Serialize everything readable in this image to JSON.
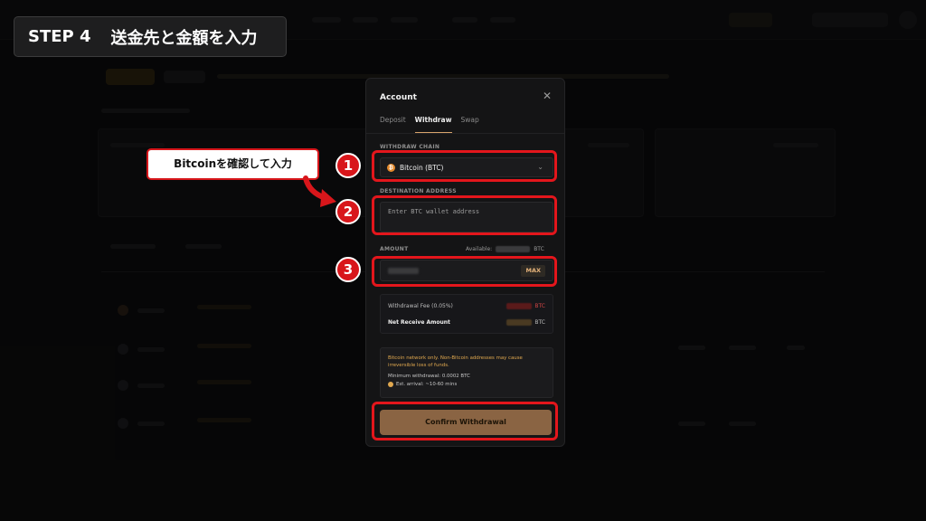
{
  "step_label": {
    "step": "STEP 4",
    "title": "送金先と金額を入力"
  },
  "modal": {
    "title": "Account",
    "close_icon": "close-icon",
    "tabs": [
      {
        "label": "Deposit",
        "active": false
      },
      {
        "label": "Withdraw",
        "active": true
      },
      {
        "label": "Swap",
        "active": false
      }
    ],
    "chain": {
      "label": "WITHDRAW CHAIN",
      "value": "Bitcoin (BTC)",
      "icon": "bitcoin-icon"
    },
    "destination": {
      "label": "DESTINATION ADDRESS",
      "placeholder": "Enter BTC wallet address"
    },
    "amount": {
      "label": "AMOUNT",
      "available_label": "Available:",
      "unit": "BTC",
      "max_label": "MAX"
    },
    "fees": {
      "fee_label": "Withdrawal Fee (0.05%)",
      "fee_unit": "BTC",
      "net_label": "Net Receive Amount",
      "net_unit": "BTC"
    },
    "notice": {
      "warning": "Bitcoin network only. Non-Bitcoin addresses may cause irreversible loss of funds.",
      "minimum": "Minimum withdrawal: 0.0002 BTC",
      "eta": "Est. arrival: ~10-60 mins"
    },
    "confirm_label": "Confirm Withdrawal"
  },
  "annotations": {
    "callout": "Bitcoinを確認して入力",
    "badges": [
      "1",
      "2",
      "3"
    ]
  },
  "colors": {
    "accent": "#d7a36b",
    "highlight_red": "#e3161c",
    "confirm_button": "#8a6443",
    "warning_text": "#e0a84f"
  }
}
